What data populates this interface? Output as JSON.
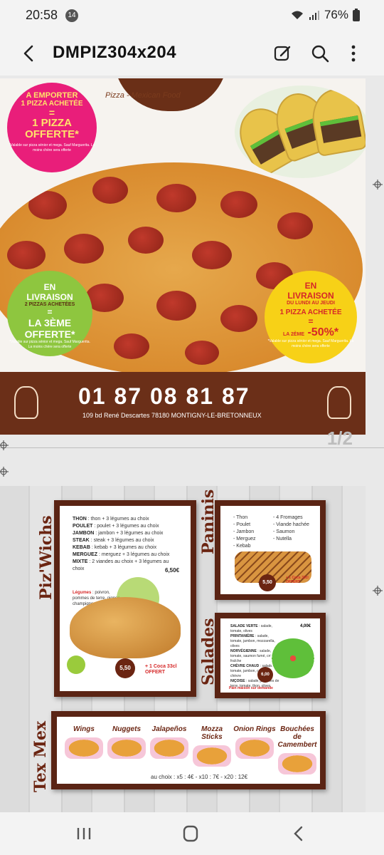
{
  "status_bar": {
    "time": "20:58",
    "notification_count": "14",
    "battery": "76%"
  },
  "app_bar": {
    "title": "DMPIZ304x204"
  },
  "page_counter": "1/2",
  "page1": {
    "tagline": "Pizza - Mexican Food",
    "promo_pink": {
      "line1": "A EMPORTER",
      "line2": "1 PIZZA ACHETÉE",
      "equals": "=",
      "line3": "1 PIZZA",
      "line4": "OFFERTE*",
      "note": "*Valable sur pizza sénior et mega. Sauf Marguerita. La moins chère sera offerte"
    },
    "promo_green": {
      "line1": "EN",
      "line2": "LIVRAISON",
      "line3": "2 PIZZAS ACHETÉES",
      "equals": "=",
      "line4": "LA 3ÈME",
      "line5": "OFFERTE*",
      "note": "*Valable sur pizza sénior et mega. Sauf Marguerita. La moins chère sera offerte"
    },
    "promo_yellow": {
      "line1": "EN",
      "line2": "LIVRAISON",
      "line3": "DU LUNDI AU JEUDI",
      "line4": "1 PIZZA ACHETÉE",
      "equals": "=",
      "line5": "LA 2ÈME",
      "line6": "-50%*",
      "note": "*Valable sur pizza sénior et mega. Sauf Marguerita. La moins chère sera offerte"
    },
    "phone": "01 87 08 81 87",
    "address": "109 bd René Descartes 78180 MONTIGNY-LE-BRETONNEUX"
  },
  "page2": {
    "pizwichs": {
      "title": "Piz'Wichs",
      "items": [
        {
          "name": "THON",
          "desc": ": thon + 3 légumes au choix"
        },
        {
          "name": "POULET",
          "desc": ": poulet + 3 légumes au choix"
        },
        {
          "name": "JAMBON",
          "desc": ": jambon + 3 légumes au choix"
        },
        {
          "name": "STEAK",
          "desc": ": steak + 3 légumes au choix"
        },
        {
          "name": "KEBAB",
          "desc": ": kebab + 3 légumes au choix"
        },
        {
          "name": "MERGUEZ",
          "desc": ": merguez + 3 légumes au choix"
        },
        {
          "name": "MIXTE",
          "desc": ": 2 viandes au choix + 3 légumes au choix"
        }
      ],
      "mixte_price": "6,50€",
      "legumes_label": "Légumes",
      "legumes_desc": ": poivron, pommes de terre, oignon, champignons, olives",
      "price": "5,50",
      "offer": "+ 1 Coca 33cl OFFERT"
    },
    "paninis": {
      "title": "Paninis",
      "col1": [
        "- Thon",
        "- Poulet",
        "- Jambon",
        "- Merguez",
        "- Kebab"
      ],
      "col2": [
        "- 4 Fromages",
        "- Viande hachée",
        "- Saumon",
        "- Nutella"
      ],
      "price": "5,50",
      "offer": "+ 1 Coca 33cl OFFERT"
    },
    "salades": {
      "title": "Salades",
      "items": [
        {
          "name": "SALADE VERTE",
          "desc": ": salade, tomate, olives",
          "price": "4,00€"
        },
        {
          "name": "PRINTANIÈRE",
          "desc": ": salade, tomate, jambon, mozzarella, olives"
        },
        {
          "name": "NORVÉGIENNE",
          "desc": ": salade, tomate, saumon fumé, crème fraîche"
        },
        {
          "name": "CHÈVRE CHAUD",
          "desc": ": salade, tomate, jambon, croûtons, chèvre"
        },
        {
          "name": "NIÇOISE",
          "desc": ": salade, pommes de terre, tomate, thon, olives"
        }
      ],
      "price": "6,00",
      "note": "Pain maison sur demande"
    },
    "texmex": {
      "title": "Tex Mex",
      "items": [
        "Wings",
        "Nuggets",
        "Jalapeños",
        "Mozza Sticks",
        "Onion Rings",
        "Bouchées de Camembert"
      ],
      "prices": "au choix : x5 : 4€ - x10 : 7€ - x20 : 12€"
    }
  },
  "colors": {
    "brown": "#6b2f18",
    "pink": "#e91e7a",
    "green": "#8ec63f",
    "yellow": "#f7d117"
  },
  "icons": [
    "back-arrow-icon",
    "edit-icon",
    "search-icon",
    "more-icon",
    "wifi-icon",
    "signal-icon",
    "battery-icon",
    "recent-apps-icon",
    "home-icon",
    "nav-back-icon"
  ]
}
